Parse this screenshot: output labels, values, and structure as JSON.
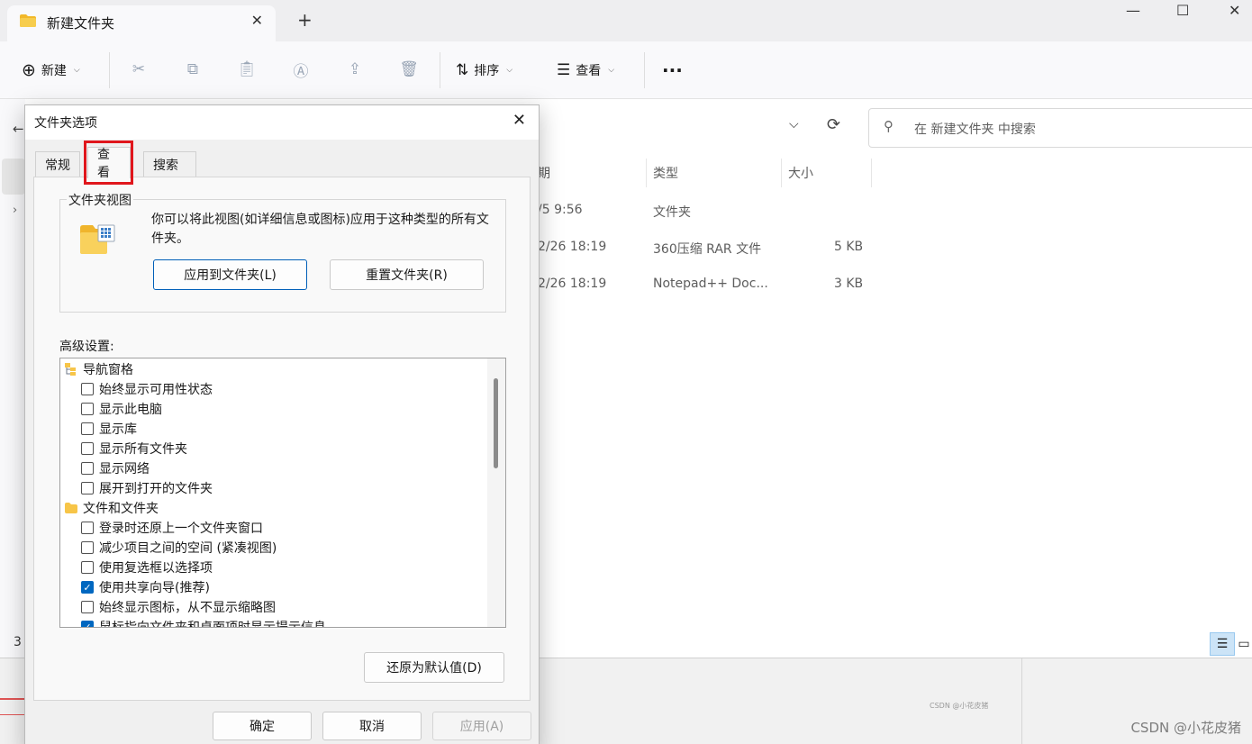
{
  "explorer": {
    "tab_title": "新建文件夹",
    "new_tab": "+",
    "toolbar": {
      "new_label": "新建",
      "sort_label": "排序",
      "view_label": "查看",
      "more": "···"
    },
    "search_placeholder": "在 新建文件夹 中搜索",
    "columns": {
      "date_partial": "期",
      "type": "类型",
      "size": "大小"
    },
    "files": [
      {
        "date_partial": "/5 9:56",
        "type": "文件夹",
        "size": ""
      },
      {
        "date_partial": "2/26 18:19",
        "type": "360压缩 RAR 文件",
        "size": "5 KB"
      },
      {
        "date_partial": "2/26 18:19",
        "type": "Notepad++ Doc...",
        "size": "3 KB"
      }
    ],
    "status_partial": "3",
    "watermark": "CSDN @小花皮猪",
    "tiny_watermark": "CSDN @小花皮猪"
  },
  "dialog": {
    "title": "文件夹选项",
    "tabs": [
      "常规",
      "查看",
      "搜索"
    ],
    "active_tab_index": 1,
    "folder_views": {
      "legend": "文件夹视图",
      "description": "你可以将此视图(如详细信息或图标)应用于这种类型的所有文件夹。",
      "apply_button": "应用到文件夹(L)",
      "reset_button": "重置文件夹(R)"
    },
    "advanced_label": "高级设置:",
    "tree": [
      {
        "kind": "group",
        "icon": "nav-pane-icon",
        "label": "导航窗格"
      },
      {
        "kind": "item",
        "checked": false,
        "label": "始终显示可用性状态"
      },
      {
        "kind": "item",
        "checked": false,
        "label": "显示此电脑"
      },
      {
        "kind": "item",
        "checked": false,
        "label": "显示库"
      },
      {
        "kind": "item",
        "checked": false,
        "label": "显示所有文件夹"
      },
      {
        "kind": "item",
        "checked": false,
        "label": "显示网络"
      },
      {
        "kind": "item",
        "checked": false,
        "label": "展开到打开的文件夹"
      },
      {
        "kind": "group",
        "icon": "folder-icon",
        "label": "文件和文件夹"
      },
      {
        "kind": "item",
        "checked": false,
        "label": "登录时还原上一个文件夹窗口"
      },
      {
        "kind": "item",
        "checked": false,
        "label": "减少项目之间的空间 (紧凑视图)"
      },
      {
        "kind": "item",
        "checked": false,
        "label": "使用复选框以选择项"
      },
      {
        "kind": "item",
        "checked": true,
        "label": "使用共享向导(推荐)"
      },
      {
        "kind": "item",
        "checked": false,
        "label": "始终显示图标，从不显示缩略图"
      },
      {
        "kind": "item",
        "checked": true,
        "label": "鼠标指向文件夹和桌面项时显示提示信息"
      }
    ],
    "restore_defaults": "还原为默认值(D)",
    "ok": "确定",
    "cancel": "取消",
    "apply": "应用(A)"
  },
  "colors": {
    "accent": "#0067c0",
    "highlight_box": "#e0161c",
    "folder_yellow": "#f7c548"
  }
}
